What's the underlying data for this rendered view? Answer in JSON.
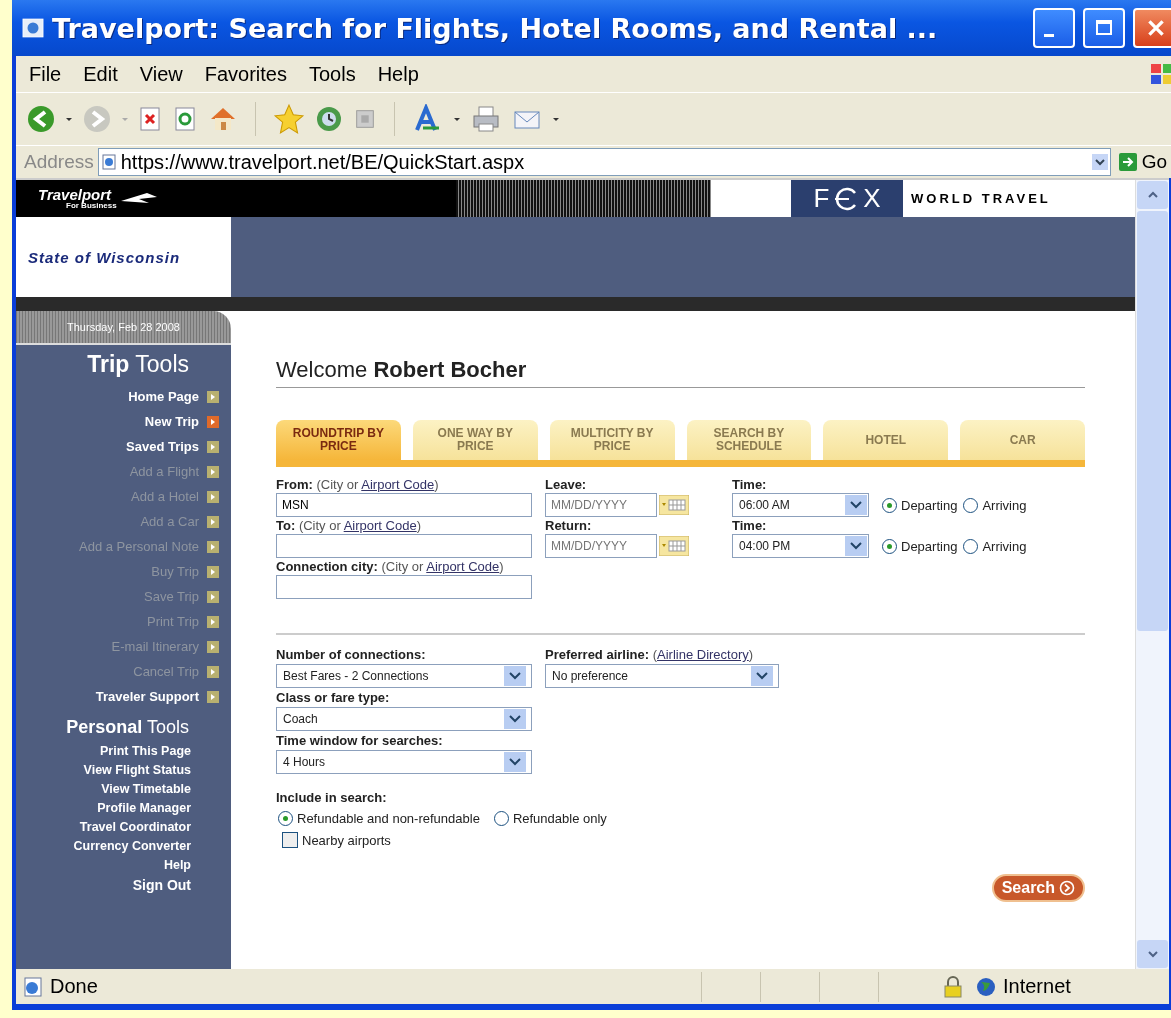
{
  "window": {
    "title": "Travelport: Search for Flights, Hotel Rooms, and Rental ..."
  },
  "menu": [
    "File",
    "Edit",
    "View",
    "Favorites",
    "Tools",
    "Help"
  ],
  "address_bar": {
    "label": "Address",
    "url": "https://www.travelport.net/BE/QuickStart.aspx",
    "go": "Go"
  },
  "header": {
    "logo": "Travelport",
    "logo_sub": "For Business",
    "agency_left": "F",
    "agency_right": "X",
    "agency_tagline": "WORLD TRAVEL",
    "client": "State of Wisconsin"
  },
  "sidebar": {
    "date": "Thursday, Feb 28 2008",
    "trip_heading": "**Trip** Tools",
    "trip_items": [
      {
        "label": "Home Page",
        "selected": false,
        "disabled": false
      },
      {
        "label": "New Trip",
        "selected": true,
        "disabled": false
      },
      {
        "label": "Saved Trips",
        "selected": false,
        "disabled": false
      },
      {
        "label": "Add a Flight",
        "selected": false,
        "disabled": true
      },
      {
        "label": "Add a Hotel",
        "selected": false,
        "disabled": true
      },
      {
        "label": "Add a Car",
        "selected": false,
        "disabled": true
      },
      {
        "label": "Add a Personal Note",
        "selected": false,
        "disabled": true
      },
      {
        "label": "Buy Trip",
        "selected": false,
        "disabled": true
      },
      {
        "label": "Save Trip",
        "selected": false,
        "disabled": true
      },
      {
        "label": "Print Trip",
        "selected": false,
        "disabled": true
      },
      {
        "label": "E-mail Itinerary",
        "selected": false,
        "disabled": true
      },
      {
        "label": "Cancel Trip",
        "selected": false,
        "disabled": true
      },
      {
        "label": "Traveler Support",
        "selected": false,
        "disabled": false
      }
    ],
    "personal_heading": "**Personal** Tools",
    "personal_items": [
      "Print This Page",
      "View Flight Status",
      "View Timetable",
      "Profile Manager",
      "Travel Coordinator",
      "Currency Converter",
      "Help"
    ],
    "sign_out": "Sign Out"
  },
  "welcome": "Welcome **Robert Bocher**",
  "tabs": [
    {
      "label": "ROUNDTRIP BY PRICE",
      "selected": true
    },
    {
      "label": "ONE WAY BY PRICE",
      "selected": false
    },
    {
      "label": "MULTICITY BY PRICE",
      "selected": false
    },
    {
      "label": "SEARCH BY SCHEDULE",
      "selected": false
    },
    {
      "label": "HOTEL",
      "selected": false
    },
    {
      "label": "CAR",
      "selected": false
    }
  ],
  "trip_rows": [
    {
      "city_label": "From:",
      "hint_pre": "(City or",
      "hint_link": "Airport Code",
      "hint_post": ")",
      "city_value": "MSN",
      "date_label": "Leave:",
      "date_placeholder": "MM/DD/YYYY",
      "time_label": "Time:",
      "time": "06:00 AM",
      "options": [
        {
          "label": "Departing",
          "selected": true
        },
        {
          "label": "Arriving",
          "selected": false
        }
      ]
    },
    {
      "city_label": "To:",
      "hint_pre": "(City or",
      "hint_link": "Airport Code",
      "hint_post": ")",
      "date_label": "Return:",
      "date_placeholder": "MM/DD/YYYY",
      "time_label": "Time:",
      "time": "04:00 PM",
      "options": [
        {
          "label": "Departing",
          "selected": true
        },
        {
          "label": "Arriving",
          "selected": false
        }
      ]
    }
  ],
  "connection": {
    "label": "Connection city:",
    "hint_pre": "(City or",
    "hint_link": "Airport Code",
    "hint_post": ")"
  },
  "preferences": {
    "connections_label": "Number of connections:",
    "connections": "Best Fares - 2 Connections",
    "airline_label": "Preferred airline:",
    "airline_pre": "(",
    "airline_link": "Airline Directory",
    "airline_post": ")",
    "airline": "No preference",
    "class_label": "Class or fare type:",
    "class": "Coach",
    "window_label": "Time window for searches:",
    "window": "4 Hours"
  },
  "include": {
    "label": "Include in search:",
    "options": [
      {
        "label": "Refundable and non-refundable",
        "selected": true
      },
      {
        "label": "Refundable only",
        "selected": false
      }
    ],
    "nearby": {
      "label": "Nearby airports",
      "checked": false
    }
  },
  "search_button": "Search",
  "status_bar": {
    "text": "Done",
    "zone": "Internet"
  }
}
